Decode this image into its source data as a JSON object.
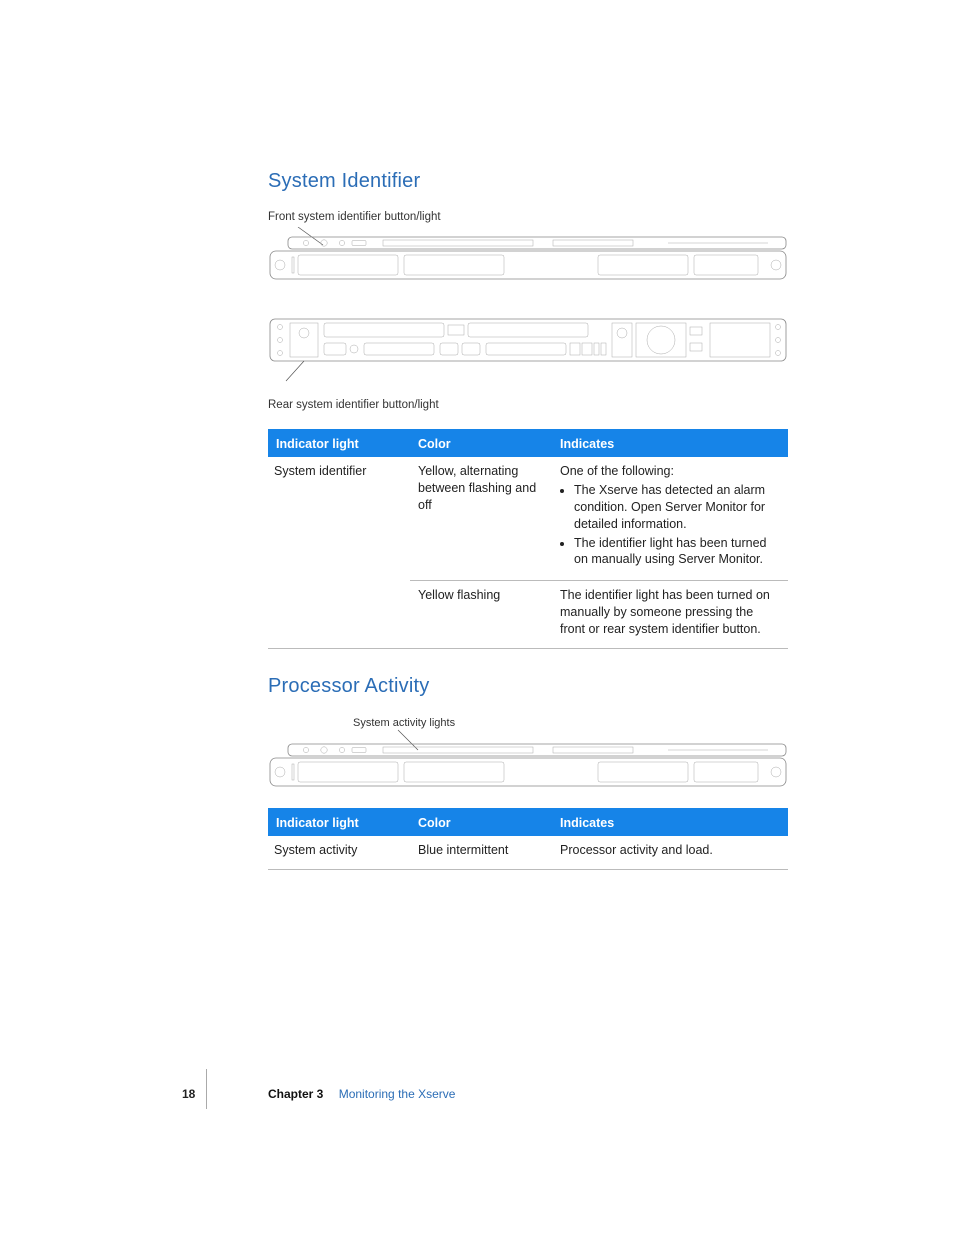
{
  "section1": {
    "title": "System Identifier",
    "frontCaption": "Front system identifier button/light",
    "rearCaption": "Rear system identifier button/light",
    "table": {
      "headers": [
        "Indicator light",
        "Color",
        "Indicates"
      ],
      "rows": [
        {
          "light": "System identifier",
          "color": "Yellow, alternating between flashing and off",
          "indicatesLead": "One of the following:",
          "indicatesBullets": [
            "The Xserve has detected an alarm condition. Open Server Monitor for detailed information.",
            "The identifier light has been turned on manually using Server Monitor."
          ]
        },
        {
          "light": "",
          "color": "Yellow flashing",
          "indicatesText": "The identifier light has been turned on manually by someone pressing the front or rear system identifier button."
        }
      ]
    }
  },
  "section2": {
    "title": "Processor Activity",
    "activityCaption": "System activity lights",
    "table": {
      "headers": [
        "Indicator light",
        "Color",
        "Indicates"
      ],
      "rows": [
        {
          "light": "System activity",
          "color": "Blue intermittent",
          "indicatesText": "Processor activity and load."
        }
      ]
    }
  },
  "footer": {
    "pageNumber": "18",
    "chapterLabel": "Chapter 3",
    "chapterTitle": "Monitoring the Xserve"
  }
}
